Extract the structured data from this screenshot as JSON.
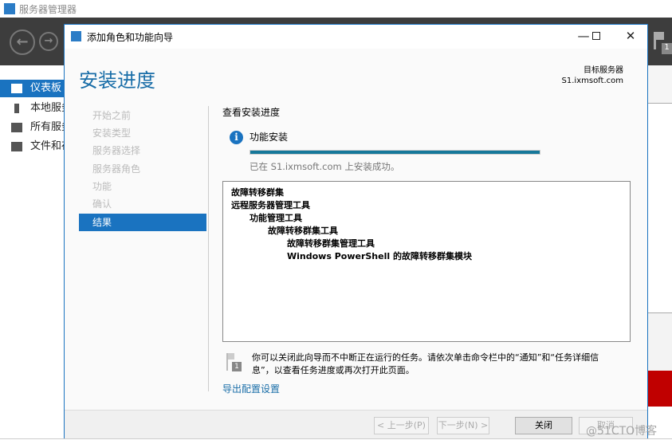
{
  "app": {
    "title": "服务器管理器",
    "notification_count": "1"
  },
  "sidebar": {
    "items": [
      {
        "label": "仪表板",
        "selected": true
      },
      {
        "label": "本地服务器"
      },
      {
        "label": "所有服务器"
      },
      {
        "label": "文件和存储服务"
      }
    ]
  },
  "dialog": {
    "title": "添加角色和功能向导",
    "heading": "安装进度",
    "target_label": "目标服务器",
    "target_server": "S1.ixmsoft.com",
    "steps": [
      {
        "label": "开始之前"
      },
      {
        "label": "安装类型"
      },
      {
        "label": "服务器选择"
      },
      {
        "label": "服务器角色"
      },
      {
        "label": "功能"
      },
      {
        "label": "确认"
      },
      {
        "label": "结果",
        "selected": true
      }
    ],
    "section_title": "查看安装进度",
    "status_title": "功能安装",
    "progress_percent": 100,
    "status_message": "已在 S1.ixmsoft.com 上安装成功。",
    "results": [
      {
        "text": "故障转移群集",
        "level": 0
      },
      {
        "text": "远程服务器管理工具",
        "level": 0
      },
      {
        "text": "功能管理工具",
        "level": 1
      },
      {
        "text": "故障转移群集工具",
        "level": 2
      },
      {
        "text": "故障转移群集管理工具",
        "level": 3
      },
      {
        "text": "Windows PowerShell 的故障转移群集模块",
        "level": 3
      }
    ],
    "note": "你可以关闭此向导而不中断正在运行的任务。请依次单击命令栏中的“通知”和“任务详细信息”，以查看任务进度或再次打开此页面。",
    "note_badge": "1",
    "export_link": "导出配置设置",
    "buttons": {
      "prev": "< 上一步(P)",
      "next": "下一步(N) >",
      "close": "关闭",
      "cancel": "取消"
    }
  },
  "watermark": "@51CTO博客",
  "colors": {
    "accent": "#1a73c0",
    "progress": "#16789a",
    "tile_red": "#c00000"
  }
}
